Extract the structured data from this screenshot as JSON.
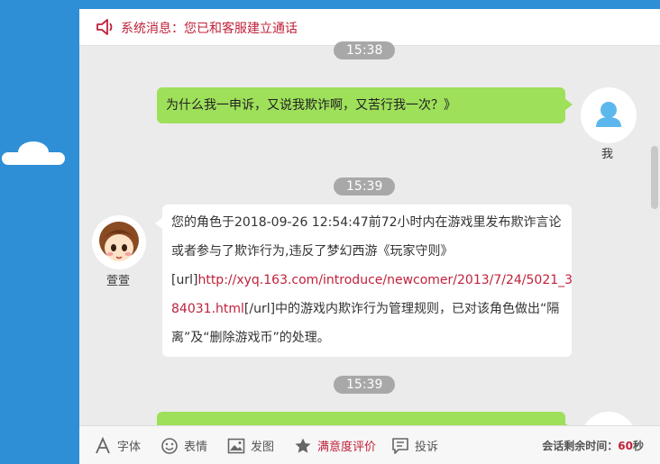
{
  "system": {
    "text": "系统消息：您已和客服建立通话"
  },
  "messages": [
    {
      "type": "time",
      "text": "15:38"
    },
    {
      "type": "user",
      "text": "为什么我一申诉，又说我欺诈啊，又苦行我一次？》",
      "name": "我"
    },
    {
      "type": "time",
      "text": "15:39"
    },
    {
      "type": "agent",
      "name": "萱萱",
      "lines": [
        "您的角色于2018-09-26 12:54:47前72小时内在游戏里发布欺诈言论",
        "或者参与了欺诈行为,违反了梦幻西游《玩家守则》",
        {
          "pre": "[url]",
          "link": "http://xyq.163.com/introduce/newcomer/2013/7/24/5021_3"
        },
        {
          "link": "84031.html",
          "post": "[/url]中的游戏内欺诈行为管理规则，已对该角色做出“隔"
        },
        "离”及“删除游戏币”的处理。"
      ]
    },
    {
      "type": "time",
      "text": "15:39"
    }
  ],
  "toolbar": {
    "items": [
      {
        "label": "字体",
        "icon": "font-icon"
      },
      {
        "label": "表情",
        "icon": "emoji-icon"
      },
      {
        "label": "发图",
        "icon": "image-icon"
      },
      {
        "label": "满意度评价",
        "icon": "star-icon",
        "active": true
      },
      {
        "label": "投诉",
        "icon": "complaint-icon"
      }
    ],
    "session_label": "会话剩余时间：",
    "session_value": "60",
    "session_unit": "秒"
  },
  "colors": {
    "accent": "#c0213a",
    "bubble_user": "#9ee05a",
    "background": "#2f8fd6"
  }
}
